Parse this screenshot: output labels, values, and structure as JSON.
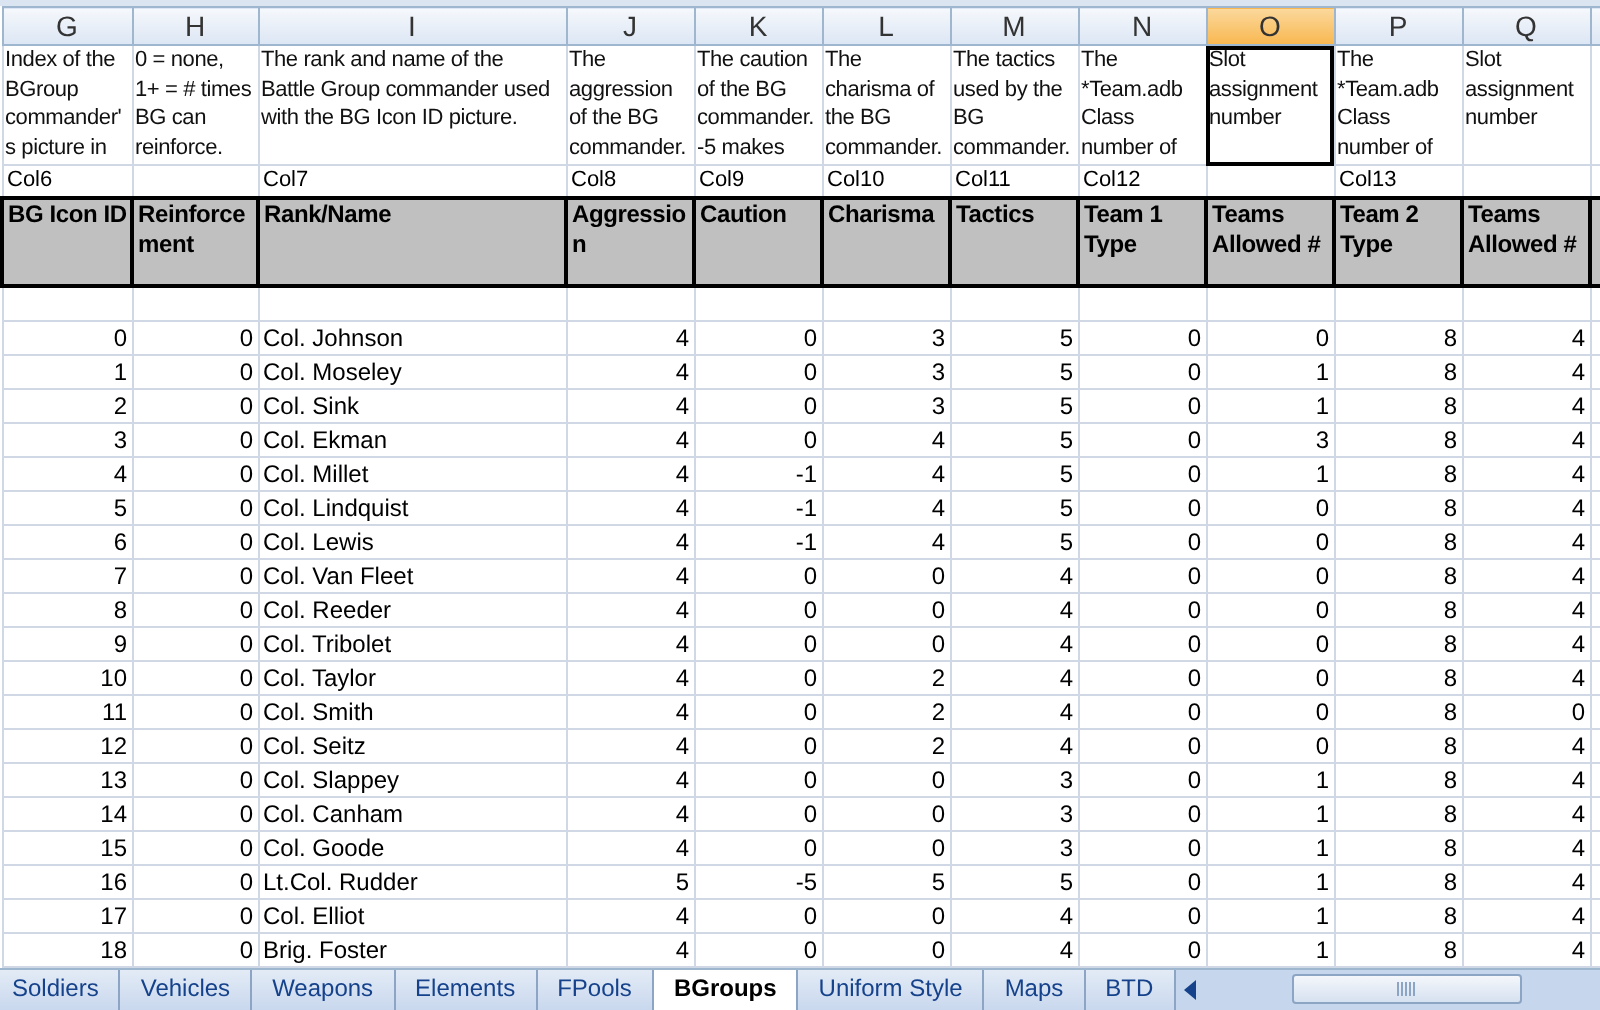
{
  "columns": [
    {
      "letter": "G",
      "selected": false,
      "description": "Index of the\nBGroup\ncommander'\ns picture in",
      "col_ref": "Col6",
      "header": "BG Icon ID",
      "kind": "number"
    },
    {
      "letter": "H",
      "selected": false,
      "description": "0 = none,\n1+ = # times\nBG can\nreinforce.",
      "header": "Reinforce\nment",
      "kind": "number"
    },
    {
      "letter": "I",
      "selected": false,
      "description": "The rank and name of the\nBattle Group commander used\nwith the BG Icon ID picture.",
      "col_ref": "Col7",
      "header": "Rank/Name",
      "kind": "text"
    },
    {
      "letter": "J",
      "selected": false,
      "description": "The\naggression\nof the BG\ncommander.",
      "col_ref": "Col8",
      "header": "Aggressio\nn",
      "kind": "number"
    },
    {
      "letter": "K",
      "selected": false,
      "description": "The caution\nof the BG\ncommander.\n-5 makes",
      "col_ref": "Col9",
      "header": "Caution",
      "kind": "number"
    },
    {
      "letter": "L",
      "selected": false,
      "description": "The\ncharisma of\nthe BG\ncommander.",
      "col_ref": "Col10",
      "header": "Charisma",
      "kind": "number"
    },
    {
      "letter": "M",
      "selected": false,
      "description": "The tactics\nused by the\nBG\ncommander.",
      "col_ref": "Col11",
      "header": "Tactics",
      "kind": "number"
    },
    {
      "letter": "N",
      "selected": false,
      "description": "The\n*Team.adb\nClass\nnumber of",
      "col_ref": "Col12",
      "header": "Team 1\nType",
      "kind": "number"
    },
    {
      "letter": "O",
      "selected": true,
      "description": "Slot\nassignment\nnumber",
      "header": "Teams\nAllowed #",
      "kind": "number"
    },
    {
      "letter": "P",
      "selected": false,
      "description": "The\n*Team.adb\nClass\nnumber of",
      "col_ref": "Col13",
      "header": "Team 2\nType",
      "kind": "number"
    },
    {
      "letter": "Q",
      "selected": false,
      "description": "Slot\nassignment\nnumber",
      "header": "Teams\nAllowed #",
      "kind": "number"
    }
  ],
  "rows": [
    [
      "0",
      "0",
      "Col. Johnson",
      "4",
      "0",
      "3",
      "5",
      "0",
      "0",
      "8",
      "4"
    ],
    [
      "1",
      "0",
      "Col. Moseley",
      "4",
      "0",
      "3",
      "5",
      "0",
      "1",
      "8",
      "4"
    ],
    [
      "2",
      "0",
      "Col. Sink",
      "4",
      "0",
      "3",
      "5",
      "0",
      "1",
      "8",
      "4"
    ],
    [
      "3",
      "0",
      "Col. Ekman",
      "4",
      "0",
      "4",
      "5",
      "0",
      "3",
      "8",
      "4"
    ],
    [
      "4",
      "0",
      "Col. Millet",
      "4",
      "-1",
      "4",
      "5",
      "0",
      "1",
      "8",
      "4"
    ],
    [
      "5",
      "0",
      "Col. Lindquist",
      "4",
      "-1",
      "4",
      "5",
      "0",
      "0",
      "8",
      "4"
    ],
    [
      "6",
      "0",
      "Col. Lewis",
      "4",
      "-1",
      "4",
      "5",
      "0",
      "0",
      "8",
      "4"
    ],
    [
      "7",
      "0",
      "Col. Van Fleet",
      "4",
      "0",
      "0",
      "4",
      "0",
      "0",
      "8",
      "4"
    ],
    [
      "8",
      "0",
      "Col. Reeder",
      "4",
      "0",
      "0",
      "4",
      "0",
      "0",
      "8",
      "4"
    ],
    [
      "9",
      "0",
      "Col. Tribolet",
      "4",
      "0",
      "0",
      "4",
      "0",
      "0",
      "8",
      "4"
    ],
    [
      "10",
      "0",
      "Col. Taylor",
      "4",
      "0",
      "2",
      "4",
      "0",
      "0",
      "8",
      "4"
    ],
    [
      "11",
      "0",
      "Col. Smith",
      "4",
      "0",
      "2",
      "4",
      "0",
      "0",
      "8",
      "0"
    ],
    [
      "12",
      "0",
      "Col. Seitz",
      "4",
      "0",
      "2",
      "4",
      "0",
      "0",
      "8",
      "4"
    ],
    [
      "13",
      "0",
      "Col. Slappey",
      "4",
      "0",
      "0",
      "3",
      "0",
      "1",
      "8",
      "4"
    ],
    [
      "14",
      "0",
      "Col. Canham",
      "4",
      "0",
      "0",
      "3",
      "0",
      "1",
      "8",
      "4"
    ],
    [
      "15",
      "0",
      "Col. Goode",
      "4",
      "0",
      "0",
      "3",
      "0",
      "1",
      "8",
      "4"
    ],
    [
      "16",
      "0",
      "Lt.Col. Rudder",
      "5",
      "-5",
      "5",
      "5",
      "0",
      "1",
      "8",
      "4"
    ],
    [
      "17",
      "0",
      "Col. Elliot",
      "4",
      "0",
      "0",
      "4",
      "0",
      "1",
      "8",
      "4"
    ],
    [
      "18",
      "0",
      "Brig. Foster",
      "4",
      "0",
      "0",
      "4",
      "0",
      "1",
      "8",
      "4"
    ]
  ],
  "sheet_tabs": [
    {
      "label": "Soldiers",
      "selected": false
    },
    {
      "label": "Vehicles",
      "selected": false
    },
    {
      "label": "Weapons",
      "selected": false
    },
    {
      "label": "Elements",
      "selected": false
    },
    {
      "label": "FPools",
      "selected": false
    },
    {
      "label": "BGroups",
      "selected": true
    },
    {
      "label": "Uniform Style",
      "selected": false
    },
    {
      "label": "Maps",
      "selected": false
    },
    {
      "label": "BTD",
      "selected": false
    }
  ]
}
